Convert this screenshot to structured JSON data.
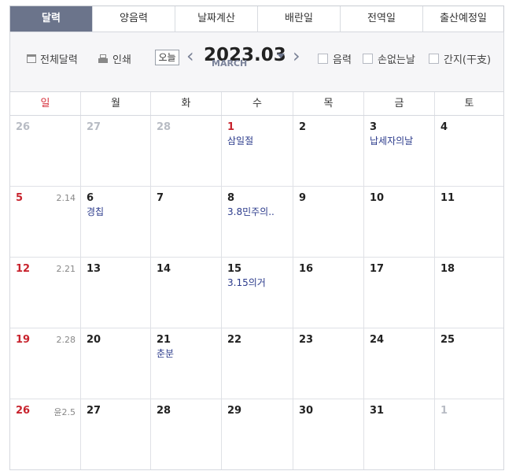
{
  "tabs": [
    {
      "label": "달력",
      "active": true
    },
    {
      "label": "양음력",
      "active": false
    },
    {
      "label": "날짜계산",
      "active": false
    },
    {
      "label": "배란일",
      "active": false
    },
    {
      "label": "전역일",
      "active": false
    },
    {
      "label": "출산예정일",
      "active": false
    }
  ],
  "toolbar": {
    "full_calendar": "전체달력",
    "print": "인쇄",
    "today": "오늘",
    "month_title": "2023.03",
    "month_sub": "MARCH",
    "prev_icon": "chevron-left-icon",
    "next_icon": "chevron-right-icon",
    "lunar_label": "음력",
    "lucky_day_label": "손없는날",
    "ganji_label": "간지(干支)"
  },
  "colors": {
    "active_tab": "#6b748b",
    "sunday": "#c8242e",
    "event": "#2d3c8c",
    "other_month": "#b8bcc4"
  },
  "weekdays": [
    "일",
    "월",
    "화",
    "수",
    "목",
    "금",
    "토"
  ],
  "weeks": [
    [
      {
        "day": "26",
        "other": true
      },
      {
        "day": "27",
        "other": true
      },
      {
        "day": "28",
        "other": true
      },
      {
        "day": "1",
        "holiday": true,
        "event": "삼일절"
      },
      {
        "day": "2"
      },
      {
        "day": "3",
        "event": "납세자의날"
      },
      {
        "day": "4"
      }
    ],
    [
      {
        "day": "5",
        "lunar": "2.14"
      },
      {
        "day": "6",
        "event": "경칩"
      },
      {
        "day": "7"
      },
      {
        "day": "8",
        "event": "3.8민주의.."
      },
      {
        "day": "9"
      },
      {
        "day": "10"
      },
      {
        "day": "11"
      }
    ],
    [
      {
        "day": "12",
        "lunar": "2.21"
      },
      {
        "day": "13"
      },
      {
        "day": "14"
      },
      {
        "day": "15",
        "event": "3.15의거"
      },
      {
        "day": "16"
      },
      {
        "day": "17"
      },
      {
        "day": "18"
      }
    ],
    [
      {
        "day": "19",
        "lunar": "2.28"
      },
      {
        "day": "20"
      },
      {
        "day": "21",
        "event": "춘분"
      },
      {
        "day": "22"
      },
      {
        "day": "23"
      },
      {
        "day": "24"
      },
      {
        "day": "25"
      }
    ],
    [
      {
        "day": "26",
        "lunar": "윤2.5"
      },
      {
        "day": "27"
      },
      {
        "day": "28"
      },
      {
        "day": "29"
      },
      {
        "day": "30"
      },
      {
        "day": "31"
      },
      {
        "day": "1",
        "other": true
      }
    ]
  ]
}
